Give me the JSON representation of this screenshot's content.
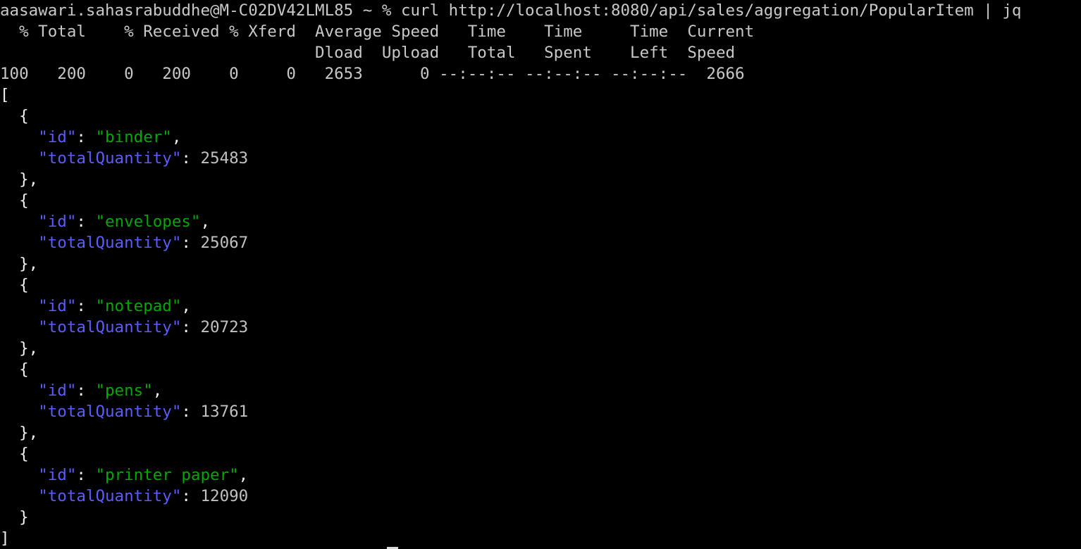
{
  "terminal": {
    "title": "Terminal",
    "background_color": "#000000",
    "foreground_color": "#c8c8c8",
    "key_color": "#5c5cfd",
    "string_color": "#00a800",
    "number_color": "#c0c0c0",
    "punct_color": "#f0f0f0",
    "font_size_px": 22.5,
    "line_height_px": 30,
    "columns": 114,
    "rows": 26
  },
  "prompt": {
    "user_host": "aasawari.sahasrabuddhe@M-C02DV42LML85",
    "cwd": "~",
    "symbol": "%",
    "command": "curl http://localhost:8080/api/sales/aggregation/PopularItem | jq",
    "full_line": "aasawari.sahasrabuddhe@M-C02DV42LML85 ~ % curl http://localhost:8080/api/sales/aggregation/PopularItem | jq"
  },
  "curl_progress": {
    "header_line_1": "  % Total    % Received % Xferd  Average Speed   Time    Time     Time  Current",
    "header_line_2": "                                 Dload  Upload   Total   Spent    Left  Speed",
    "data_line": "100   200    0   200    0     0   2653      0 --:--:-- --:--:-- --:--:--  2666",
    "columns": [
      "% Total",
      "% Received",
      "% Xferd",
      "Average Speed Dload",
      "Average Speed Upload",
      "Time Total",
      "Time Spent",
      "Time Left",
      "Current Speed"
    ],
    "values": {
      "percent_total": "100",
      "total": "200",
      "percent_received": "0",
      "received": "200",
      "percent_xferd": "0",
      "xferd": "0",
      "average_dload": "2653",
      "average_upload": "0",
      "time_total": "--:--:--",
      "time_spent": "--:--:--",
      "time_left": "--:--:--",
      "current_speed": "2666"
    }
  },
  "json_output": {
    "open_bracket": "[",
    "close_bracket": "]",
    "key_id": "\"id\"",
    "key_total_quantity": "\"totalQuantity\"",
    "items": [
      {
        "id": "binder",
        "id_quoted": "\"binder\"",
        "totalQuantity": "25483"
      },
      {
        "id": "envelopes",
        "id_quoted": "\"envelopes\"",
        "totalQuantity": "25067"
      },
      {
        "id": "notepad",
        "id_quoted": "\"notepad\"",
        "totalQuantity": "20723"
      },
      {
        "id": "pens",
        "id_quoted": "\"pens\"",
        "totalQuantity": "13761"
      },
      {
        "id": "printer paper",
        "id_quoted": "\"printer paper\"",
        "totalQuantity": "12090"
      }
    ],
    "punctuation": {
      "brace_open": "{",
      "brace_close_comma": "},",
      "brace_close": "}",
      "colon": ": ",
      "comma": ",",
      "indent_1": "  ",
      "indent_2": "    "
    }
  }
}
